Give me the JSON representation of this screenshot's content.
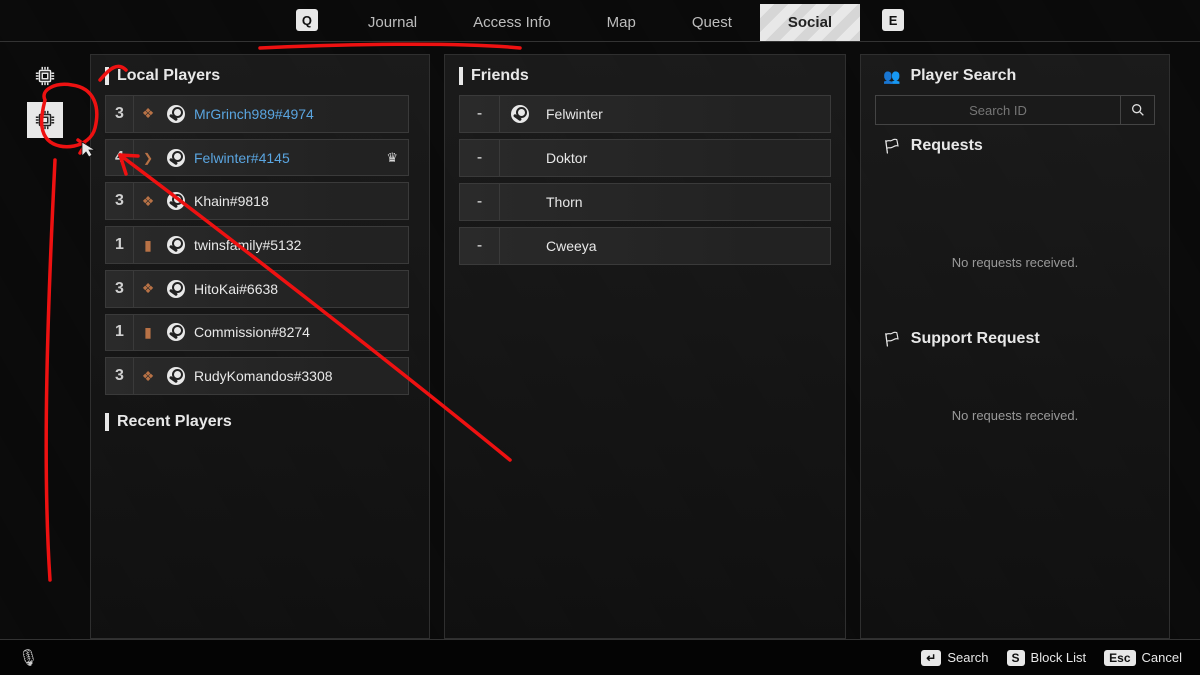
{
  "topbar": {
    "key_left": "Q",
    "key_right": "E",
    "tabs": [
      {
        "label": "Journal"
      },
      {
        "label": "Access Info"
      },
      {
        "label": "Map"
      },
      {
        "label": "Quest"
      },
      {
        "label": "Social"
      }
    ],
    "active_tab": "Social"
  },
  "left_panel": {
    "local_players_header": "Local Players",
    "recent_players_header": "Recent Players",
    "players": [
      {
        "party": "3",
        "rank": "crest",
        "platform": "steam",
        "name": "MrGrinch989#4974",
        "highlight": true,
        "crown": false,
        "expanded": false
      },
      {
        "party": "4",
        "rank": "chev",
        "platform": "steam",
        "name": "Felwinter#4145",
        "highlight": true,
        "crown": true,
        "expanded": true
      },
      {
        "party": "3",
        "rank": "crest",
        "platform": "steam",
        "name": "Khain#9818",
        "highlight": false,
        "crown": false,
        "expanded": false
      },
      {
        "party": "1",
        "rank": "bar",
        "platform": "steam",
        "name": "twinsfamily#5132",
        "highlight": false,
        "crown": false,
        "expanded": false
      },
      {
        "party": "3",
        "rank": "crest",
        "platform": "steam",
        "name": "HitoKai#6638",
        "highlight": false,
        "crown": false,
        "expanded": false
      },
      {
        "party": "1",
        "rank": "bar",
        "platform": "steam",
        "name": "Commission#8274",
        "highlight": false,
        "crown": false,
        "expanded": false
      },
      {
        "party": "3",
        "rank": "crest",
        "platform": "steam",
        "name": "RudyKomandos#3308",
        "highlight": false,
        "crown": false,
        "expanded": false
      }
    ]
  },
  "mid_panel": {
    "friends_header": "Friends",
    "friends": [
      {
        "status": "-",
        "platform": "steam",
        "name": "Felwinter"
      },
      {
        "status": "-",
        "platform": "",
        "name": "Doktor"
      },
      {
        "status": "-",
        "platform": "",
        "name": "Thorn"
      },
      {
        "status": "-",
        "platform": "",
        "name": "Cweeya"
      }
    ]
  },
  "right_panel": {
    "player_search_header": "Player Search",
    "search_placeholder": "Search ID",
    "requests_header": "Requests",
    "requests_empty": "No requests received.",
    "support_header": "Support Request",
    "support_empty": "No requests received."
  },
  "bottombar": {
    "hints": [
      {
        "key": "↵",
        "label": "Search"
      },
      {
        "key": "S",
        "label": "Block List"
      },
      {
        "key": "Esc",
        "label": "Cancel"
      }
    ]
  },
  "annotation": {
    "color": "#e11",
    "target": "chip-button-2"
  }
}
